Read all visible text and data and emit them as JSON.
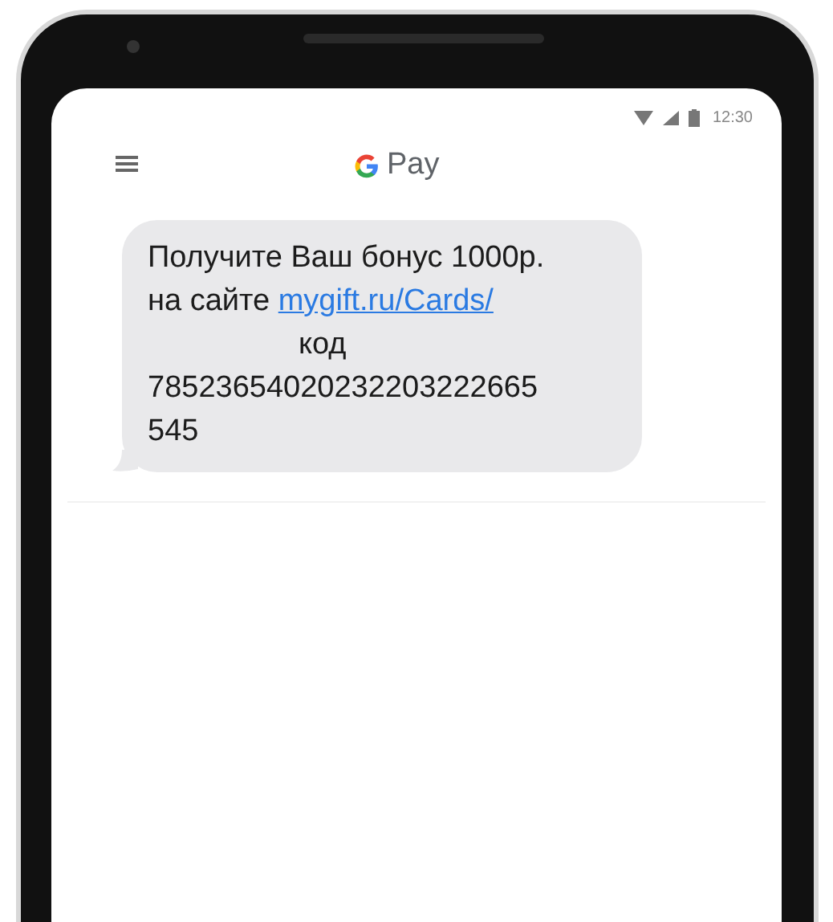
{
  "status_bar": {
    "time": "12:30"
  },
  "header": {
    "logo_text": "Pay"
  },
  "message": {
    "line_1": "Получите Ваш бонус 1000р.",
    "line_2_prefix": "на сайте",
    "link": "mygift.ru/Cards/",
    "code_label": "код",
    "code_line_1": "78523654020232203222665",
    "code_line_2": "545"
  }
}
